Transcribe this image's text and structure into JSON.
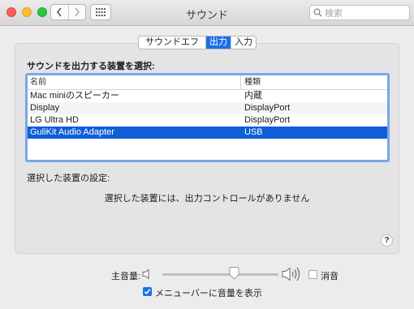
{
  "window": {
    "title": "サウンド",
    "search_placeholder": "検索"
  },
  "tabs": [
    {
      "label": "サウンドエフェクト",
      "selected": false
    },
    {
      "label": "出力",
      "selected": true
    },
    {
      "label": "入力",
      "selected": false
    }
  ],
  "output": {
    "heading": "サウンドを出力する装置を選択:",
    "columns": [
      "名前",
      "種類"
    ],
    "devices": [
      {
        "name": "Mac miniのスピーカー",
        "type": "内蔵",
        "selected": false
      },
      {
        "name": "Display",
        "type": "DisplayPort",
        "selected": false
      },
      {
        "name": "LG Ultra HD",
        "type": "DisplayPort",
        "selected": false
      },
      {
        "name": "GuliKit Audio Adapter",
        "type": "USB",
        "selected": true
      }
    ],
    "settings_label": "選択した装置の設定:",
    "no_controls_message": "選択した装置には、出力コントロールがありません"
  },
  "help": {
    "label": "?"
  },
  "volume": {
    "label": "主音量:",
    "level": 0.62,
    "mute_label": "消音",
    "muted": false
  },
  "menubar": {
    "label": "メニューバーに音量を表示",
    "checked": true
  },
  "colors": {
    "accent": "#1b6fe6",
    "selection": "#0e5fd8",
    "focus_ring": "#7aa6e9"
  }
}
